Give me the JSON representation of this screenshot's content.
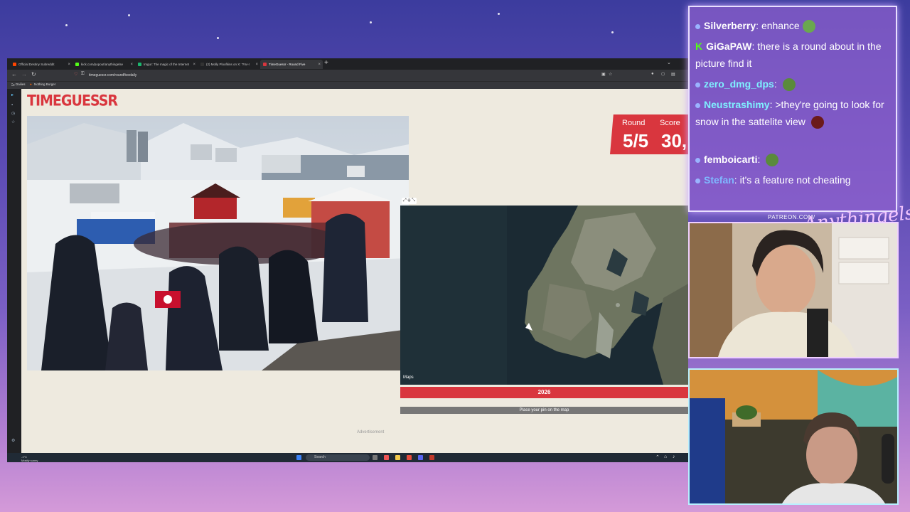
{
  "browser": {
    "tabs": [
      {
        "label": "Official Destiny Subreddit",
        "color": "#ff4500",
        "active": false
      },
      {
        "label": "kick.com/popout/anythingelse",
        "color": "#53fc18",
        "active": false
      },
      {
        "label": "Imgur: The magic of the Internet",
        "color": "#1bb76e",
        "active": false
      },
      {
        "label": "(2) Molly Ploofkins on X: \"Far-r",
        "color": "#333333",
        "active": false
      },
      {
        "label": "TimeGuessr - Round Five",
        "color": "#d9363e",
        "active": true
      }
    ],
    "url": "timeguessr.com/roundfivedaily",
    "bookmarks": [
      {
        "label": "Dailies"
      },
      {
        "label": "Nothing Burger"
      }
    ]
  },
  "game": {
    "logo": "TIMEGUESSR",
    "round_label": "Round",
    "score_label": "Score",
    "round_value": "5/5",
    "score_value": "30,",
    "year": "2026",
    "pin_prompt": "Place your pin on the map",
    "maps_label": " Maps",
    "advertisement": "Advertisement",
    "slider_position": 0.99
  },
  "taskbar": {
    "search_placeholder": "Search",
    "weather_temp": "-1°C",
    "weather_desc": "Mostly sunny"
  },
  "chat": {
    "messages": [
      {
        "user": "Silverberry",
        "text": "enhance",
        "user_color": "#ffffff",
        "badge": "dot",
        "emote": "#6aa84f"
      },
      {
        "user": "GiGaPAW",
        "text": "there is a round about in the picture find it",
        "user_color": "#ffffff",
        "badge": "kick",
        "emote": ""
      },
      {
        "user": "zero_dmg_dps",
        "text": "",
        "user_color": "#7ff0ff",
        "badge": "dot",
        "emote": "#5a8a3c"
      },
      {
        "user": "Neustrashimy",
        "text": ">they're going to look for snow in the sattelite view",
        "user_color": "#7ff0ff",
        "badge": "dot",
        "emote": "#6b1a1a"
      },
      {
        "user": "femboicarti",
        "text": "",
        "user_color": "#ffffff",
        "badge": "dot",
        "emote": "#5a8a3c"
      },
      {
        "user": "Stefan",
        "text": "it's a feature  not cheating",
        "user_color": "#7fb8ff",
        "badge": "dot",
        "emote": "#6b1a1a"
      }
    ]
  },
  "overlay": {
    "patreon": "PATREON.COM/",
    "signature": "Anythingelse"
  }
}
